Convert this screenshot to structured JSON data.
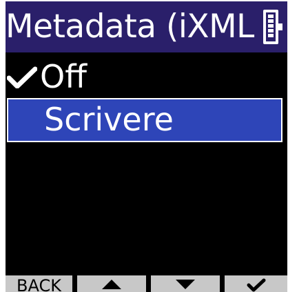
{
  "title": "Metadata (iXML",
  "battery_icon": "battery-icon",
  "menu": {
    "items": [
      {
        "label": "Off",
        "checked": true,
        "selected": false
      },
      {
        "label": "Scrivere",
        "checked": false,
        "selected": true
      }
    ],
    "check_icon": "check-icon"
  },
  "footer": {
    "back_label": "BACK",
    "up_icon": "triangle-up-icon",
    "down_icon": "triangle-down-icon",
    "ok_icon": "check-icon"
  },
  "colors": {
    "title_bg": "#2a1f6a",
    "selected_bg": "#2e45b8",
    "screen_bg": "#000000",
    "footer_bg": "#c8c8c8"
  }
}
